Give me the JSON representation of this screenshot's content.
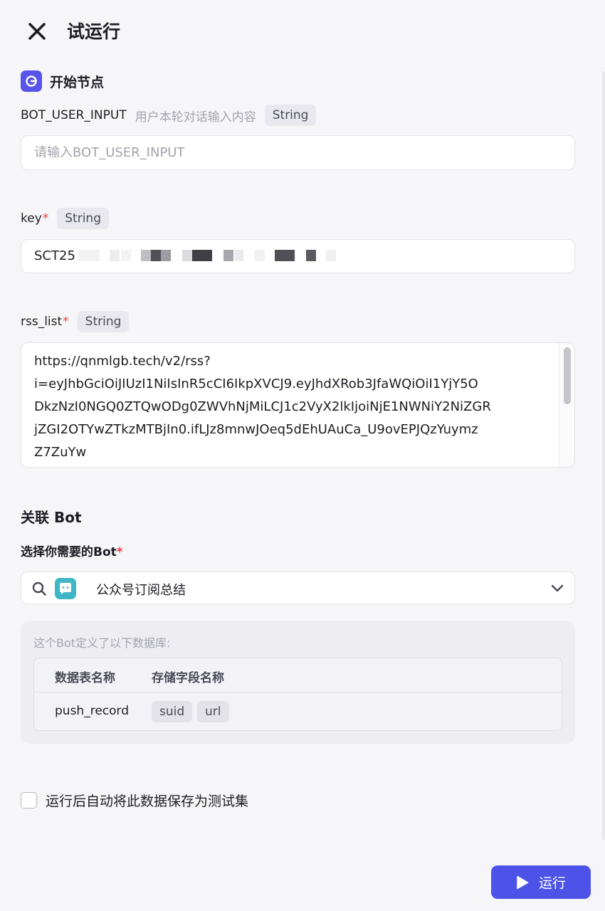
{
  "header": {
    "title": "试运行"
  },
  "start_node": {
    "title": "开始节点",
    "color": "#5754ec"
  },
  "fields": {
    "bot_user_input": {
      "label": "BOT_USER_INPUT",
      "description": "用户本轮对话输入内容",
      "type": "String",
      "placeholder": "请输入BOT_USER_INPUT",
      "value": ""
    },
    "key": {
      "label": "key",
      "required_mark": "*",
      "type": "String",
      "value": "SCT25"
    },
    "rss_list": {
      "label": "rss_list",
      "required_mark": "*",
      "type": "String",
      "value": "https://qnmlgb.tech/v2/rss?\ni=eyJhbGciOiJIUzI1NiIsInR5cCI6IkpXVCJ9.eyJhdXRob3JfaWQiOiI1YjY5O\nDkzNzI0NGQ0ZTQwODg0ZWVhNjMiLCJ1c2VyX2lkIjoiNjE1NWNiY2NiZGR\njZGI2OTYwZTkzMTBjIn0.ifLJz8mnwJOeq5dEhUAuCa_U9ovEPJQzYuymz\nZ7ZuYw"
    }
  },
  "bot_section": {
    "title": "关联 Bot",
    "select_label": "选择你需要的Bot",
    "required_mark": "*",
    "selected_bot": "公众号订阅总结",
    "database_note": "这个Bot定义了以下数据库:",
    "table": {
      "columns": [
        "数据表名称",
        "存储字段名称"
      ],
      "rows": [
        {
          "name": "push_record",
          "fields": [
            "suid",
            "url"
          ]
        }
      ]
    }
  },
  "save_option": {
    "label": "运行后自动将此数据保存为测试集",
    "checked": false
  },
  "run_button": {
    "label": "运行",
    "color": "#4d53e8"
  },
  "icons": {
    "close": "close-icon",
    "start_node": "start-node-icon",
    "search": "search-icon",
    "bot_avatar": "bot-avatar-icon",
    "chevron": "chevron-down-icon",
    "play": "play-icon"
  }
}
